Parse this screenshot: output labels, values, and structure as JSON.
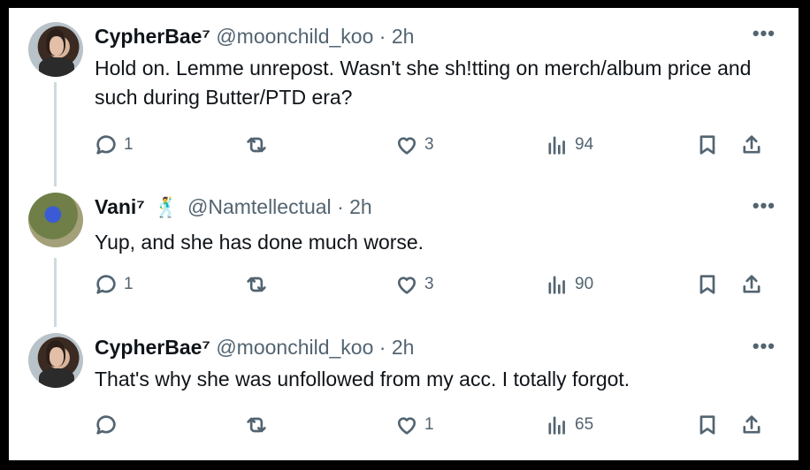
{
  "tweets": [
    {
      "name": "CypherBae⁷",
      "handle": "@moonchild_koo",
      "time": "· 2h",
      "emoji": "",
      "text": "Hold on. Lemme unrepost. Wasn't she sh!tting on merch/album price and such during Butter/PTD era?",
      "replies": "1",
      "reposts": "",
      "likes": "3",
      "views": "94",
      "avatar": "cypher"
    },
    {
      "name": "Vani⁷",
      "handle": "@Namtellectual",
      "time": "· 2h",
      "emoji": "🕺",
      "text": "Yup, and she has done much worse.",
      "replies": "1",
      "reposts": "",
      "likes": "3",
      "views": "90",
      "avatar": "vani"
    },
    {
      "name": "CypherBae⁷",
      "handle": "@moonchild_koo",
      "time": "· 2h",
      "emoji": "",
      "text": "That's why she was unfollowed from my acc. I totally forgot.",
      "replies": "",
      "reposts": "",
      "likes": "1",
      "views": "65",
      "avatar": "cypher"
    }
  ],
  "icons": {
    "more": "more-options-icon",
    "reply": "reply-icon",
    "repost": "repost-icon",
    "like": "like-icon",
    "views": "views-icon",
    "bookmark": "bookmark-icon",
    "share": "share-icon"
  },
  "colors": {
    "text": "#0f1419",
    "secondary": "#536471",
    "thread_line": "#cfd9de"
  }
}
